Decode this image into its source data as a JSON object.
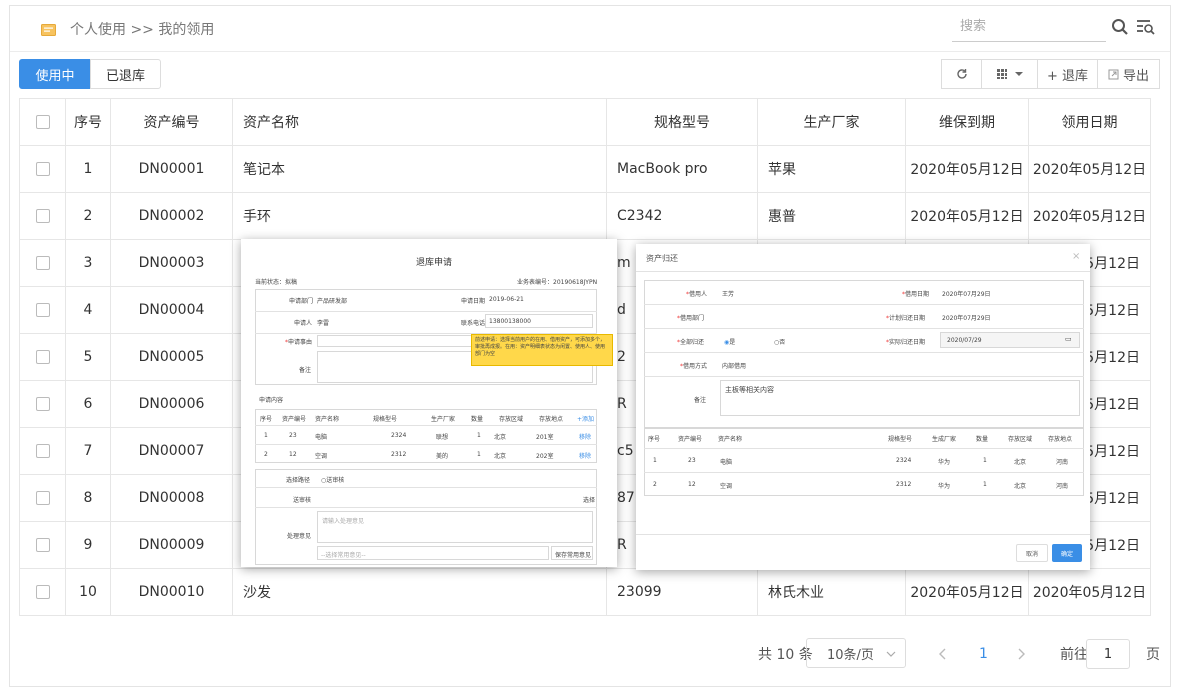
{
  "header": {
    "breadcrumb": "个人使用 >> 我的领用",
    "search_placeholder": "搜索"
  },
  "tabs": {
    "active": "使用中",
    "inactive": "已退库"
  },
  "toolbar": {
    "return_label": "+ 退库",
    "export_label": "导出"
  },
  "columns": [
    "序号",
    "资产编号",
    "资产名称",
    "规格型号",
    "生产厂家",
    "维保到期",
    "领用日期"
  ],
  "rows": [
    {
      "no": "1",
      "code": "DN00001",
      "name": "笔记本",
      "spec": "MacBook pro",
      "maker": "苹果",
      "warranty": "2020年05月12日",
      "date": "2020年05月12日"
    },
    {
      "no": "2",
      "code": "DN00002",
      "name": "手环",
      "spec": "C2342",
      "maker": "惠普",
      "warranty": "2020年05月12日",
      "date": "2020年05月12日"
    },
    {
      "no": "3",
      "code": "DN00003",
      "name": "",
      "spec": "m",
      "maker": "",
      "warranty": "",
      "date": "05月12日"
    },
    {
      "no": "4",
      "code": "DN00004",
      "name": "",
      "spec": "d",
      "maker": "",
      "warranty": "",
      "date": "05月12日"
    },
    {
      "no": "5",
      "code": "DN00005",
      "name": "",
      "spec": "2",
      "maker": "",
      "warranty": "",
      "date": "05月12日"
    },
    {
      "no": "6",
      "code": "DN00006",
      "name": "",
      "spec": "R",
      "maker": "",
      "warranty": "",
      "date": "05月12日"
    },
    {
      "no": "7",
      "code": "DN00007",
      "name": "",
      "spec": "c5",
      "maker": "",
      "warranty": "",
      "date": "05月12日"
    },
    {
      "no": "8",
      "code": "DN00008",
      "name": "",
      "spec": "87",
      "maker": "",
      "warranty": "",
      "date": "05月12日"
    },
    {
      "no": "9",
      "code": "DN00009",
      "name": "",
      "spec": "R",
      "maker": "",
      "warranty": "",
      "date": "05月12日"
    },
    {
      "no": "10",
      "code": "DN00010",
      "name": "沙发",
      "spec": "23099",
      "maker": "林氏木业",
      "warranty": "2020年05月12日",
      "date": "2020年05月12日"
    }
  ],
  "pagination": {
    "total": "共 10 条",
    "page_size": "10条/页",
    "current": "1",
    "goto": "前往",
    "goto_value": "1",
    "page_unit": "页"
  },
  "dialog1": {
    "title": "退库申请",
    "status": "当前状态：拟稿",
    "number": "业务表编号：20190618JYPN",
    "dept_label": "申请部门",
    "dept": "产品研发部",
    "date_label": "申请日期",
    "date": "2019-06-21",
    "applicant_label": "申请人",
    "applicant": "李雷",
    "phone_label": "联系电话",
    "phone": "13800138000",
    "reason_label": "申请事由",
    "remark_label": "备注",
    "content_label": "申请内容",
    "tooltip": "前述申请：选择当前用户的在用、借用资产，可添加多个，审批再成报。在用：资产明细表状态为闲置、使用人、使用部门为空",
    "item_headers": [
      "序号",
      "资产编号",
      "资产名称",
      "规格型号",
      "生产厂家",
      "数量",
      "存放区域",
      "存放地点"
    ],
    "add_label": "+添加",
    "items": [
      [
        "1",
        "23",
        "电脑",
        "2324",
        "联想",
        "1",
        "北京",
        "201室"
      ],
      [
        "2",
        "12",
        "空调",
        "2312",
        "美的",
        "1",
        "北京",
        "202室"
      ]
    ],
    "delete_label": "移除",
    "route_label": "选择路径",
    "route_option": "送审核",
    "reviewer_label": "送审核",
    "choose_label": "选择",
    "opinion_label": "处理意见",
    "opinion_placeholder": "请输入处理意见",
    "common_select": "--选择常用意见--",
    "save_common": "保存常用意见"
  },
  "dialog2": {
    "title": "资产归还",
    "close_icon": "×",
    "borrower_label": "借用人",
    "borrower": "王芳",
    "borrow_date_label": "借用日期",
    "borrow_date": "2020年07月29日",
    "borrow_dept_label": "借用部门",
    "borrow_dept": "",
    "plan_date_label": "计划归还日期",
    "plan_date": "2020年07月29日",
    "all_return_label": "全部归还",
    "yes": "是",
    "no": "否",
    "actual_date_label": "实际归还日期",
    "actual_date": "2020/07/29",
    "method_label": "借用方式",
    "method": "内部借用",
    "remark_label": "备注",
    "remark": "主板等相关内容",
    "item_headers": [
      "序号",
      "资产编号",
      "资产名称",
      "规格型号",
      "生成厂家",
      "数量",
      "存放区域",
      "存放地点"
    ],
    "items": [
      [
        "1",
        "23",
        "电脑",
        "2324",
        "华为",
        "1",
        "北京",
        "河南"
      ],
      [
        "2",
        "12",
        "空调",
        "2312",
        "华为",
        "1",
        "北京",
        "河南"
      ]
    ],
    "cancel": "取消",
    "confirm": "确定"
  },
  "colors": {
    "accent": "#3a8ee6",
    "tooltip": "#ffd84a"
  }
}
